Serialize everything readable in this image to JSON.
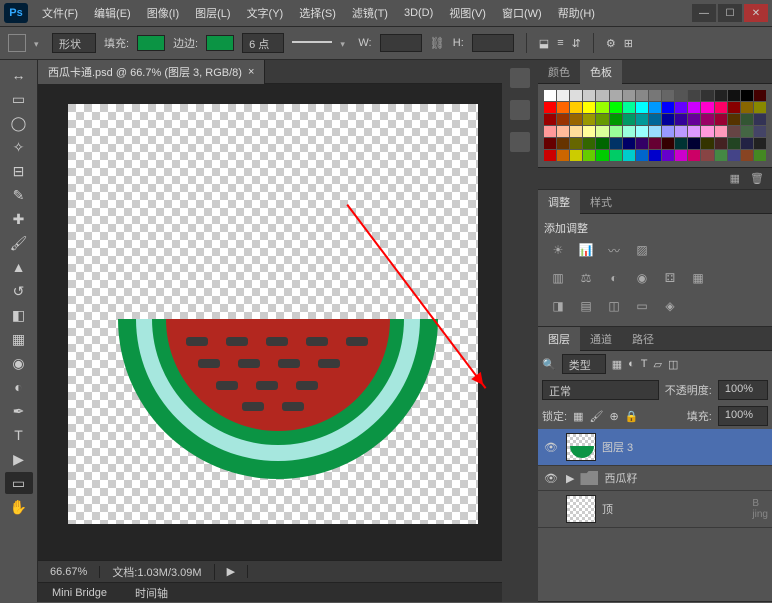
{
  "menu": {
    "items": [
      "文件(F)",
      "编辑(E)",
      "图像(I)",
      "图层(L)",
      "文字(Y)",
      "选择(S)",
      "滤镜(T)",
      "3D(D)",
      "视图(V)",
      "窗口(W)",
      "帮助(H)"
    ]
  },
  "option_bar": {
    "shape": "形状",
    "fill": "填充:",
    "stroke": "边边:",
    "stroke_pt": "6 点",
    "w": "W:",
    "h": "H:"
  },
  "doc": {
    "tab": "西瓜卡通.psd @ 66.7% (图层 3, RGB/8)",
    "zoom": "66.67%",
    "docinfo": "文档:1.03M/3.09M"
  },
  "bottom": {
    "mini": "Mini Bridge",
    "timeline": "时间轴"
  },
  "panels": {
    "color_tab": "颜色",
    "swatch_tab": "色板",
    "adjust_tab": "调整",
    "style_tab": "样式",
    "adjust_title": "添加调整",
    "layer_tab": "图层",
    "channel_tab": "通道",
    "path_tab": "路径",
    "kind": "类型",
    "blend": "正常",
    "opacity_lbl": "不透明度:",
    "opacity": "100%",
    "lock": "锁定:",
    "fill_lbl": "填充:",
    "fill": "100%",
    "layer3": "图层 3",
    "group1": "西瓜籽",
    "bglayer": "顶"
  },
  "watermark": "B\njing",
  "colors": [
    [
      "#fff",
      "#eee",
      "#ddd",
      "#ccc",
      "#bbb",
      "#aaa",
      "#999",
      "#888",
      "#777",
      "#666",
      "#555",
      "#444",
      "#333",
      "#222",
      "#111",
      "#000",
      "#400"
    ],
    [
      "#f00",
      "#f60",
      "#fc0",
      "#ff0",
      "#9f0",
      "#0f0",
      "#0f9",
      "#0ff",
      "#09f",
      "#00f",
      "#60f",
      "#c0f",
      "#f0c",
      "#f06",
      "#800",
      "#860",
      "#880"
    ],
    [
      "#900",
      "#930",
      "#960",
      "#990",
      "#690",
      "#090",
      "#096",
      "#099",
      "#069",
      "#009",
      "#309",
      "#609",
      "#906",
      "#903",
      "#530",
      "#353",
      "#335"
    ],
    [
      "#f99",
      "#fb9",
      "#fd9",
      "#ff9",
      "#df9",
      "#9f9",
      "#9fd",
      "#9ff",
      "#9df",
      "#99f",
      "#b9f",
      "#d9f",
      "#f9d",
      "#f9b",
      "#644",
      "#464",
      "#446"
    ],
    [
      "#600",
      "#630",
      "#660",
      "#360",
      "#060",
      "#036",
      "#006",
      "#306",
      "#603",
      "#300",
      "#033",
      "#003",
      "#330",
      "#422",
      "#242",
      "#224",
      "#222"
    ],
    [
      "#c00",
      "#c60",
      "#cc0",
      "#6c0",
      "#0c0",
      "#0c6",
      "#0cc",
      "#06c",
      "#00c",
      "#60c",
      "#c0c",
      "#c06",
      "#844",
      "#484",
      "#448",
      "#842",
      "#482"
    ]
  ]
}
